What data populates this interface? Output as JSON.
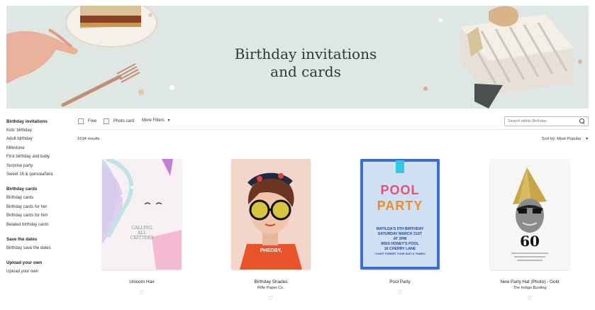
{
  "hero": {
    "title_line1": "Birthday invitations",
    "title_line2": "and cards",
    "bg_color": "#dfe7e4"
  },
  "sidebar": {
    "sections": [
      {
        "heading": "Birthday invitations",
        "items": [
          "Kids' birthday",
          "Adult birthday",
          "Milestone",
          "First birthday and baby",
          "Surprise party",
          "Sweet 16 & quinceañera"
        ]
      },
      {
        "heading": "Birthday cards",
        "items": [
          "Birthday cards",
          "Birthday cards for her",
          "Birthday cards for him",
          "Belated birthday cards"
        ]
      },
      {
        "heading": "Save the dates",
        "items": [
          "Birthday save the dates"
        ]
      },
      {
        "heading": "Upload your own",
        "items": [
          "Upload your own"
        ]
      }
    ]
  },
  "filters": {
    "free_label": "Free",
    "photo_label": "Photo card",
    "more_label": "More Filters",
    "search_placeholder": "Search within Birthday"
  },
  "results_count": "1634 results",
  "sort_label": "Sort by: Most Popular",
  "cards": [
    {
      "title": "Unicorn Hair",
      "brand": "",
      "art_text": [
        "CALLING",
        "ALL",
        "CRITTERS"
      ]
    },
    {
      "title": "Birthday Shades",
      "brand": "Rifle Paper Co.",
      "art_text": [
        "PHEOBY,"
      ]
    },
    {
      "title": "Pool Party",
      "brand": "",
      "art_text": [
        "POOL",
        "PARTY",
        "MATILDA'S 6TH BIRTHDAY",
        "SATURDAY MARCH 31ST",
        "AT 2PM",
        "MISS HONEY'S POOL",
        "16 CHERRY LANE",
        "* DON'T FORGET YOUR SUIT & TOWEL!"
      ]
    },
    {
      "title": "New Party Hat (Photo) - Gold",
      "brand": "The Indigo Bunting",
      "art_text": [
        "60"
      ]
    }
  ],
  "icons": {
    "heart": "heart-outline-icon",
    "search": "search-icon",
    "caret": "caret-down-icon"
  }
}
